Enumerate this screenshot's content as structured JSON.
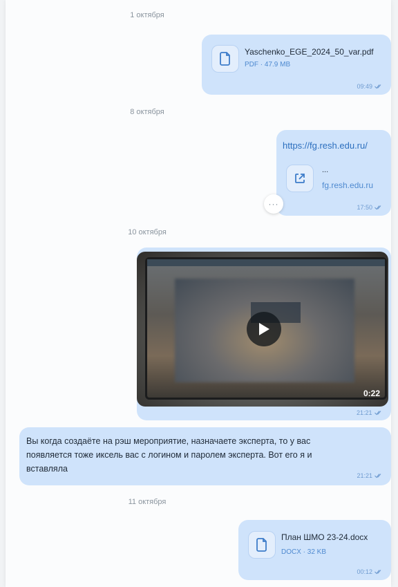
{
  "dates": {
    "d1": "1 октября",
    "d2": "8 октября",
    "d3": "10 октября",
    "d4": "11 октября"
  },
  "messages": {
    "file1": {
      "name": "Yaschenko_EGE_2024_50_var.pdf",
      "meta": "PDF · 47.9 MB",
      "time": "09:49"
    },
    "link": {
      "url": "https://fg.resh.edu.ru/",
      "title": "...",
      "domain": "fg.resh.edu.ru",
      "time": "17:50"
    },
    "video": {
      "duration": "0:22",
      "time": "21:21"
    },
    "text": {
      "body": "Вы когда создаёте на рэш мероприятие, назначаете эксперта, то у вас появляется тоже иксель вас с логином и паролем эксперта. Вот его я и вставляла",
      "time": "21:21"
    },
    "file2": {
      "name": "План ШМО 23-24.docx",
      "meta": "DOCX · 32 KB",
      "time": "00:12"
    }
  },
  "more_button": "···",
  "colors": {
    "bubble": "#cfe3fb",
    "accent": "#4f8ad0",
    "page": "#fbfcfd"
  }
}
